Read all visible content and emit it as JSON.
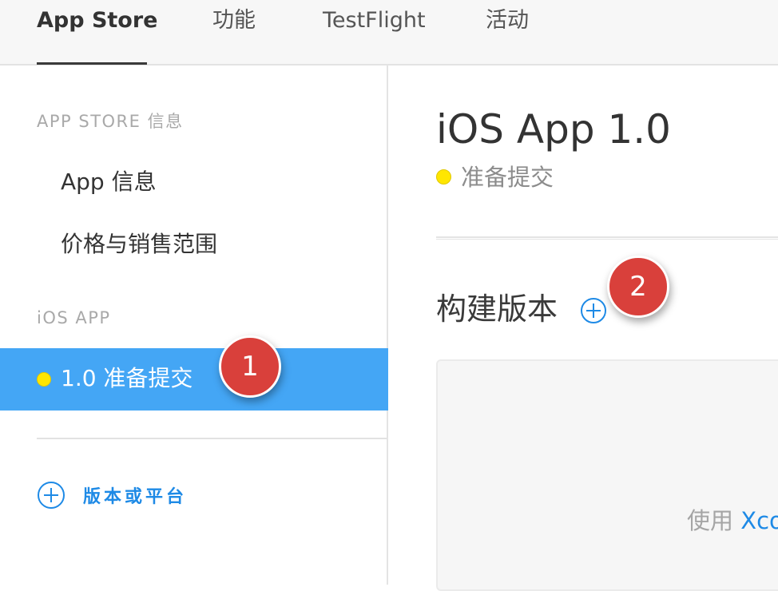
{
  "tabs": [
    {
      "label": "App Store",
      "active": true
    },
    {
      "label": "功能",
      "active": false
    },
    {
      "label": "TestFlight",
      "active": false
    },
    {
      "label": "活动",
      "active": false
    }
  ],
  "sidebar": {
    "section_app_store": "APP STORE 信息",
    "app_info": "App 信息",
    "pricing": "价格与销售范围",
    "section_ios": "iOS APP",
    "selected_version": "1.0 准备提交",
    "add_version_label": "版本或平台"
  },
  "main": {
    "title": "iOS App 1.0",
    "status": "准备提交",
    "builds_heading": "构建版本",
    "build_hint_prefix": "使用 ",
    "build_hint_link": "Xco"
  },
  "callouts": {
    "first": "1",
    "second": "2"
  },
  "colors": {
    "accent_blue": "#1e8ae6",
    "selected_bg": "#44a6f5",
    "status_yellow": "#ffe600",
    "callout_red": "#d9403b"
  },
  "icons": {
    "add_version": "plus-circle-icon",
    "add_build": "plus-circle-icon",
    "status": "status-dot-icon"
  }
}
